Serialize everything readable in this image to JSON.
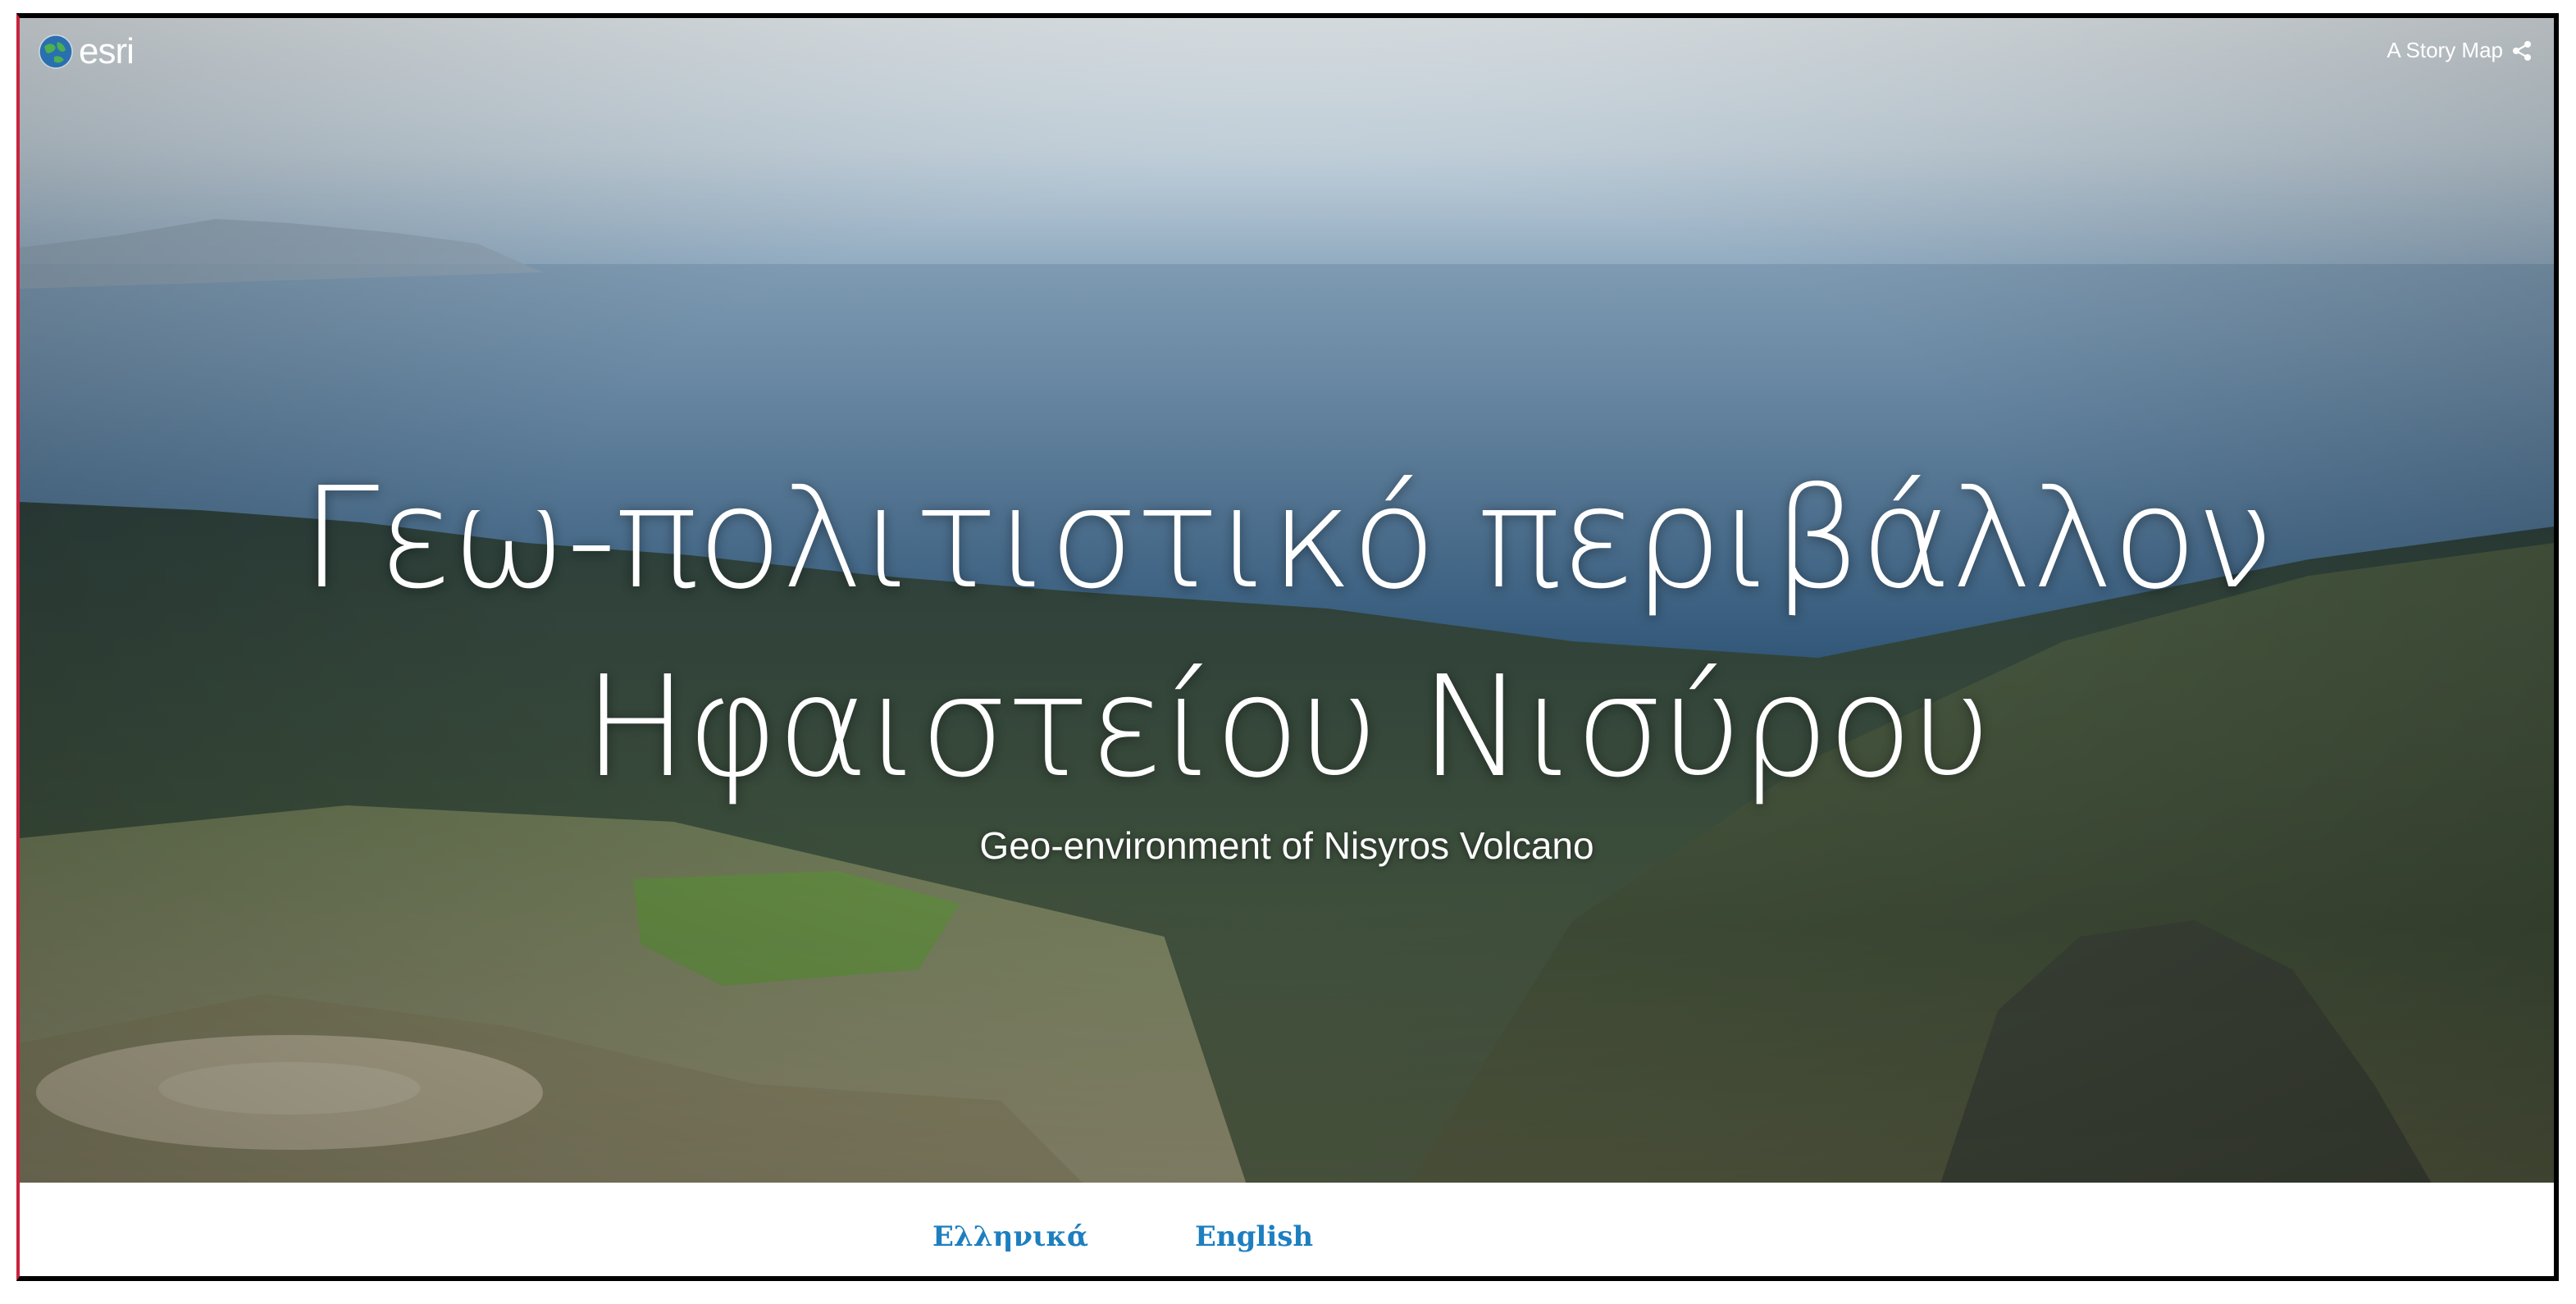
{
  "header": {
    "brand_text": "esri",
    "brand_icon": "globe-icon",
    "storymap_label": "A Story Map",
    "share_icon": "share-icon"
  },
  "hero": {
    "title_line1": "Γεω-πολιτιστικό περιβάλλον",
    "title_line2": "Ηφαιστείου Νισύρου",
    "subtitle": "Geo-environment of Nisyros Volcano"
  },
  "languages": {
    "greek": "Ελληνικά",
    "english": "English"
  },
  "colors": {
    "link": "#1d7fc0",
    "frame": "#000000"
  }
}
